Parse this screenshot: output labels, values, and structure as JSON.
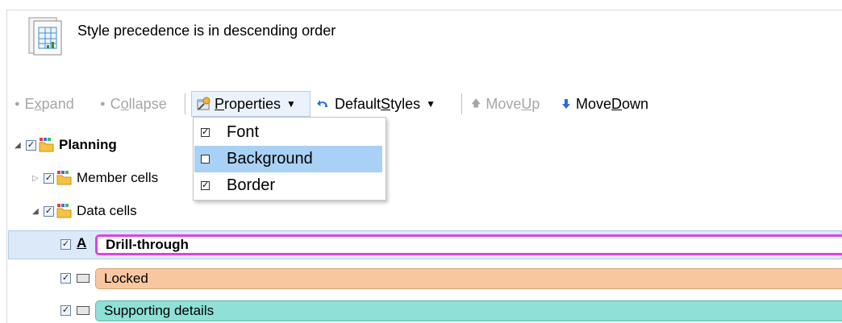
{
  "header": {
    "text": "Style precedence is in descending order",
    "icon": "styles-document-icon"
  },
  "toolbar": {
    "expand": {
      "pre": "E",
      "u": "x",
      "post": "pand"
    },
    "collapse": {
      "pre": "C",
      "u": "o",
      "post": "llapse"
    },
    "properties": {
      "pre": "",
      "u": "P",
      "post": "roperties"
    },
    "default_styles": {
      "pre": "Default ",
      "u": "S",
      "post": "tyles"
    },
    "move_up": {
      "pre": "Move ",
      "u": "U",
      "post": "p"
    },
    "move_down": {
      "pre": "Move ",
      "u": "D",
      "post": "own"
    }
  },
  "properties_menu": {
    "items": [
      {
        "label": "Font",
        "checked": true
      },
      {
        "label": "Background",
        "checked": false,
        "highlighted": true
      },
      {
        "label": "Border",
        "checked": true
      }
    ]
  },
  "tree": {
    "root": {
      "label": "Planning",
      "checked": true,
      "expanded": true
    },
    "member_cells": {
      "label": "Member cells",
      "checked": true,
      "expanded": false
    },
    "data_cells": {
      "label": "Data cells",
      "checked": true,
      "expanded": true
    },
    "styles": [
      {
        "label": "Drill-through",
        "checked": true,
        "icon": "font-style-icon",
        "selected": true,
        "fill": "#ffffff",
        "border": "#e040e8"
      },
      {
        "label": "Locked",
        "checked": true,
        "icon": "cell-style-icon",
        "fill": "#f8c7a0",
        "border": "#d9a27a"
      },
      {
        "label": "Supporting details",
        "checked": true,
        "icon": "cell-style-icon",
        "fill": "#8fe0d6",
        "border": "#5fb8ad"
      }
    ]
  },
  "colors": {
    "selection": "#dbe9f9",
    "menu_highlight": "#a9d1f5",
    "arrow_blue": "#2a6edc"
  }
}
